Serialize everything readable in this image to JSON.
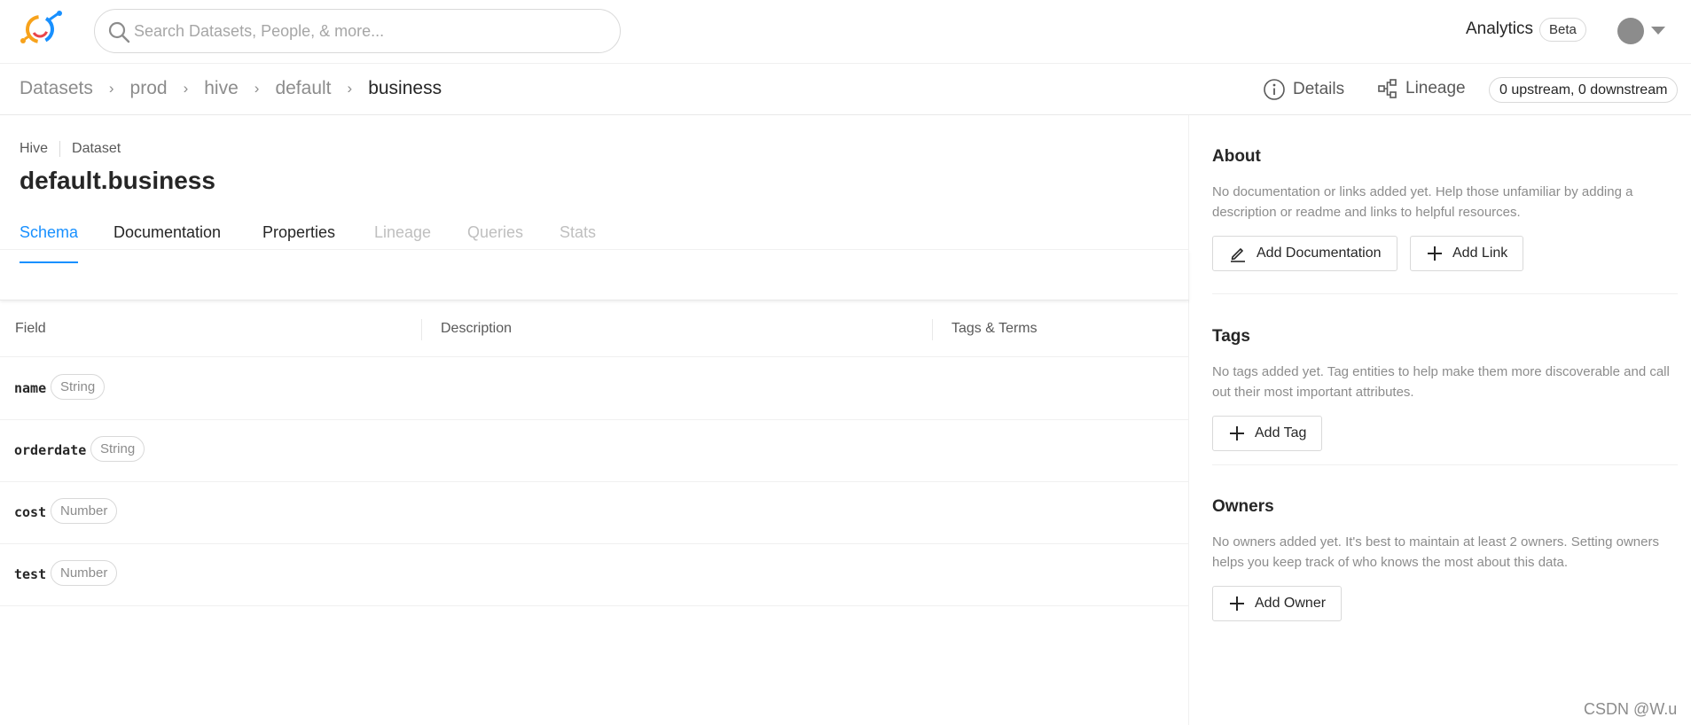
{
  "header": {
    "search_placeholder": "Search Datasets, People, & more...",
    "analytics_label": "Analytics",
    "beta_label": "Beta"
  },
  "breadcrumb": {
    "items": [
      "Datasets",
      "prod",
      "hive",
      "default",
      "business"
    ],
    "separator": "›"
  },
  "actions": {
    "details_label": "Details",
    "lineage_label": "Lineage",
    "upstream_label": "0 upstream, 0 downstream"
  },
  "entity": {
    "platform": "Hive",
    "type": "Dataset",
    "title": "default.business"
  },
  "tabs": [
    {
      "label": "Schema",
      "state": "active"
    },
    {
      "label": "Documentation",
      "state": "enabled"
    },
    {
      "label": "Properties",
      "state": "enabled"
    },
    {
      "label": "Lineage",
      "state": "disabled"
    },
    {
      "label": "Queries",
      "state": "disabled"
    },
    {
      "label": "Stats",
      "state": "disabled"
    }
  ],
  "schema": {
    "columns": [
      "Field",
      "Description",
      "Tags & Terms"
    ],
    "rows": [
      {
        "field": "name",
        "type": "String"
      },
      {
        "field": "orderdate",
        "type": "String"
      },
      {
        "field": "cost",
        "type": "Number"
      },
      {
        "field": "test",
        "type": "Number"
      }
    ]
  },
  "sidebar": {
    "about": {
      "title": "About",
      "text": "No documentation or links added yet. Help those unfamiliar by adding a description or readme and links to helpful resources.",
      "add_documentation_label": "Add Documentation",
      "add_link_label": "Add Link"
    },
    "tags": {
      "title": "Tags",
      "text": "No tags added yet. Tag entities to help make them more discoverable and call out their most important attributes.",
      "add_tag_label": "Add Tag"
    },
    "owners": {
      "title": "Owners",
      "text": "No owners added yet. It's best to maintain at least 2 owners. Setting owners helps you keep track of who knows the most about this data.",
      "add_owner_label": "Add Owner"
    }
  },
  "watermark": "CSDN @W.u",
  "colors": {
    "accent": "#1890ff",
    "logo_orange": "#f7a21b",
    "logo_blue": "#1890ff",
    "logo_red": "#e9454a"
  },
  "icons": [
    "datahub-logo-icon",
    "search-icon",
    "info-icon",
    "lineage-icon",
    "edit-icon",
    "plus-icon",
    "chevron-down-icon"
  ]
}
